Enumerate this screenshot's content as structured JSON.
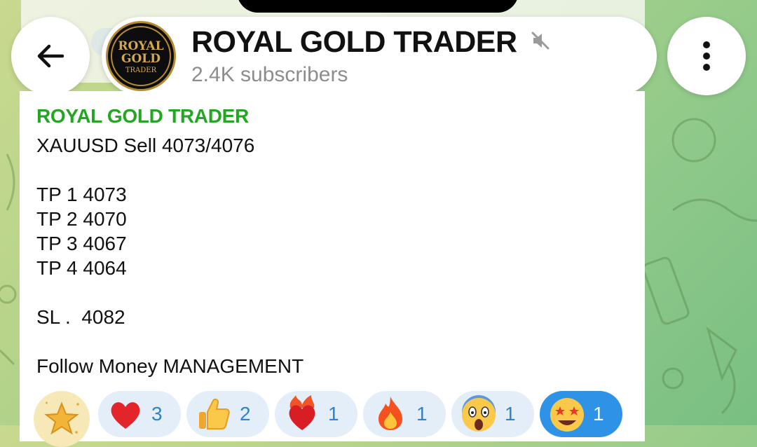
{
  "header": {
    "title": "ROYAL GOLD TRADER",
    "subtitle": "2.4K subscribers",
    "avatar_text": [
      "ROYAL",
      "GOLD",
      "TRADER"
    ],
    "muted": true
  },
  "background_message": {
    "count": "1"
  },
  "message": {
    "sender": "ROYAL GOLD TRADER",
    "lines": [
      "XAUUSD Sell 4073/4076",
      "",
      "TP 1 4073",
      "TP 2 4070",
      "TP 3 4067",
      "TP 4 4064",
      "",
      "SL .  4082",
      "",
      "Follow Money MANAGEMENT"
    ]
  },
  "reactions": [
    {
      "icon": "heart-icon",
      "count": "3",
      "active": false
    },
    {
      "icon": "thumbs-up-icon",
      "count": "2",
      "active": false
    },
    {
      "icon": "heart-on-fire-icon",
      "count": "1",
      "active": false
    },
    {
      "icon": "fire-icon",
      "count": "1",
      "active": false
    },
    {
      "icon": "screaming-face-icon",
      "count": "1",
      "active": false
    },
    {
      "icon": "star-struck-icon",
      "count": "1",
      "active": true
    }
  ],
  "colors": {
    "sender": "#23a723",
    "reaction_count": "#2a83d6",
    "active_reaction": "#2e93e6",
    "subtitle": "#8d8d8d"
  }
}
